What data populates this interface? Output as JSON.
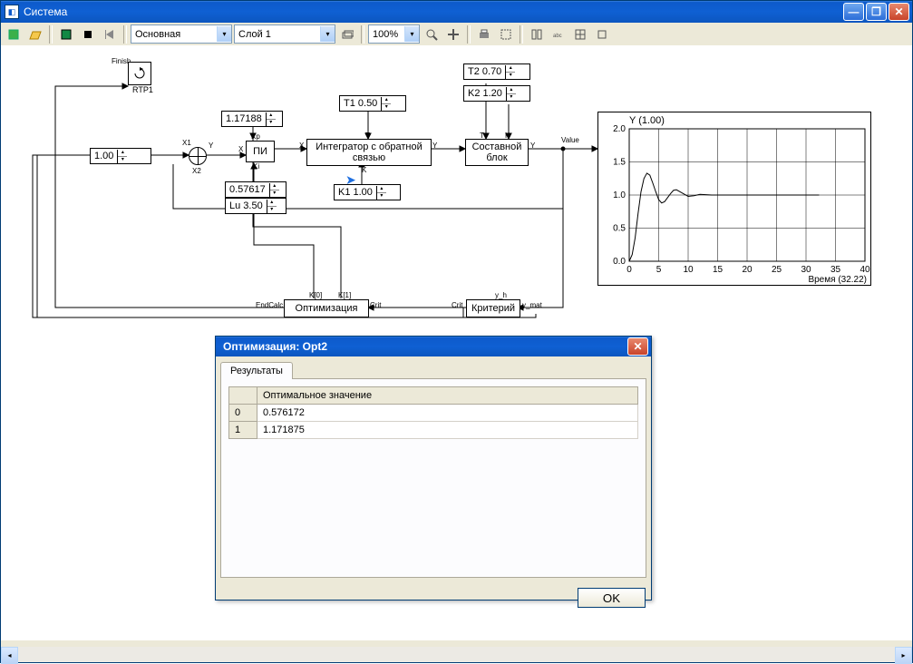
{
  "window": {
    "title": "Система"
  },
  "toolbar": {
    "combos": {
      "main": "Основная",
      "layer": "Слой 1",
      "zoom": "100%"
    }
  },
  "diagram": {
    "rtp": {
      "label": "RTP1",
      "pinlabel": "Finish"
    },
    "const1": "1.00",
    "kp": "1.17188",
    "ki": "0.57617",
    "lu": "Lu  3.50",
    "pi_block": "ПИ",
    "integrator": "Интегратор с обратной\nсвязью",
    "t1": "T1  0.50",
    "k1": "K1  1.00",
    "t2": "T2  0.70",
    "k2": "K2  1.20",
    "composite": "Составной\nблок",
    "optimization": "Оптимизация",
    "criterion": "Критерий",
    "portlabels": {
      "x": "X",
      "y": "Y",
      "kp": "Kp",
      "ki": "Ki",
      "k": "K",
      "t": "T",
      "x1": "X1",
      "x2": "X2",
      "value": "Value",
      "endcalc": "EndCalc",
      "k0": "K[0]",
      "k1": "K[1]",
      "crit": "Crit",
      "yh": "y_h",
      "ymat": "y_mat"
    }
  },
  "chart_data": {
    "type": "line",
    "title": "Y (1.00)",
    "xlabel": "Время (32.22)",
    "ylabel": "",
    "xlim": [
      0,
      40
    ],
    "ylim": [
      0,
      2
    ],
    "xticks": [
      0,
      5,
      10,
      15,
      20,
      25,
      30,
      35,
      40
    ],
    "yticks": [
      0.0,
      0.5,
      1.0,
      1.5,
      2.0
    ],
    "series": [
      {
        "name": "Y",
        "x": [
          0,
          0.5,
          1,
          1.5,
          2,
          2.5,
          3,
          3.5,
          4,
          4.5,
          5,
          5.5,
          6,
          6.5,
          7,
          7.5,
          8,
          9,
          10,
          11,
          12,
          14,
          16,
          20,
          25,
          30,
          32.22
        ],
        "y": [
          0,
          0.1,
          0.35,
          0.72,
          1.05,
          1.25,
          1.33,
          1.3,
          1.18,
          1.05,
          0.93,
          0.88,
          0.9,
          0.96,
          1.02,
          1.07,
          1.08,
          1.03,
          0.98,
          0.99,
          1.01,
          1.0,
          1.0,
          1.0,
          1.0,
          1.0,
          1.0
        ]
      }
    ]
  },
  "dialog": {
    "title": "Оптимизация: Opt2",
    "tab": "Результаты",
    "header": "Оптимальное значение",
    "rows": [
      {
        "idx": "0",
        "val": "0.576172"
      },
      {
        "idx": "1",
        "val": "1.171875"
      }
    ],
    "ok": "OK"
  }
}
